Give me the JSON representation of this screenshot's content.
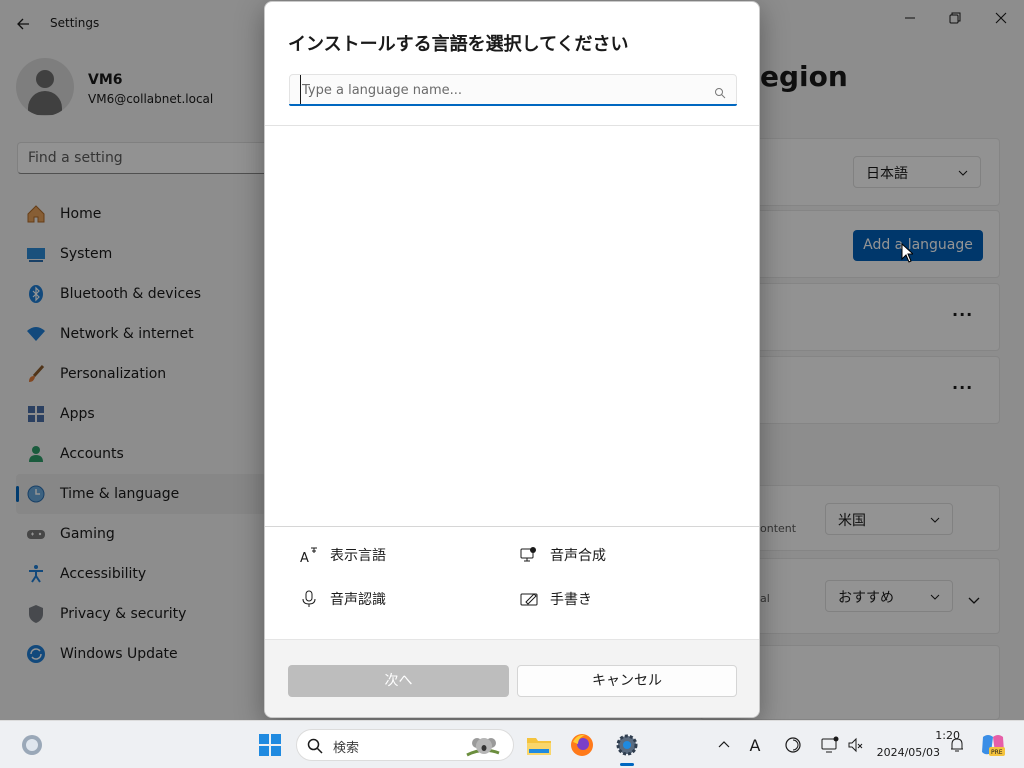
{
  "window": {
    "title": "Settings",
    "back_icon": "back-arrow-icon",
    "controls": [
      "minimize-icon",
      "restore-icon",
      "close-icon"
    ]
  },
  "profile": {
    "name": "VM6",
    "email": "VM6@collabnet.local"
  },
  "search": {
    "placeholder": "Find a setting"
  },
  "sidebar": {
    "items": [
      {
        "label": "Home",
        "icon": "home-icon"
      },
      {
        "label": "System",
        "icon": "system-icon"
      },
      {
        "label": "Bluetooth & devices",
        "icon": "bluetooth-icon"
      },
      {
        "label": "Network & internet",
        "icon": "wifi-icon"
      },
      {
        "label": "Personalization",
        "icon": "brush-icon"
      },
      {
        "label": "Apps",
        "icon": "apps-icon"
      },
      {
        "label": "Accounts",
        "icon": "accounts-icon"
      },
      {
        "label": "Time & language",
        "icon": "time-language-icon",
        "active": true
      },
      {
        "label": "Gaming",
        "icon": "gamepad-icon"
      },
      {
        "label": "Accessibility",
        "icon": "accessibility-icon"
      },
      {
        "label": "Privacy & security",
        "icon": "shield-icon"
      },
      {
        "label": "Windows Update",
        "icon": "update-icon"
      }
    ]
  },
  "main": {
    "heading_visible": "egion",
    "display_language_value": "日本語",
    "add_language_label": "Add a language",
    "country_sublabel": "ontent",
    "country_value": "米国",
    "format_sublabel": "al",
    "format_value": "おすすめ"
  },
  "dialog": {
    "title": "インストールする言語を選択してください",
    "search_placeholder": "Type a language name...",
    "features": [
      {
        "label": "表示言語",
        "icon": "display-language-icon"
      },
      {
        "label": "音声合成",
        "icon": "text-to-speech-icon"
      },
      {
        "label": "音声認識",
        "icon": "microphone-icon"
      },
      {
        "label": "手書き",
        "icon": "handwriting-icon"
      }
    ],
    "next_label": "次へ",
    "cancel_label": "キャンセル"
  },
  "taskbar": {
    "search_label": "検索",
    "clock_time": "1:20",
    "clock_date": "2024/05/03",
    "ime_indicator": "A"
  },
  "colors": {
    "accent": "#005fb8",
    "focus_underline": "#0067c0",
    "disabled_button": "#bdbdbd"
  }
}
